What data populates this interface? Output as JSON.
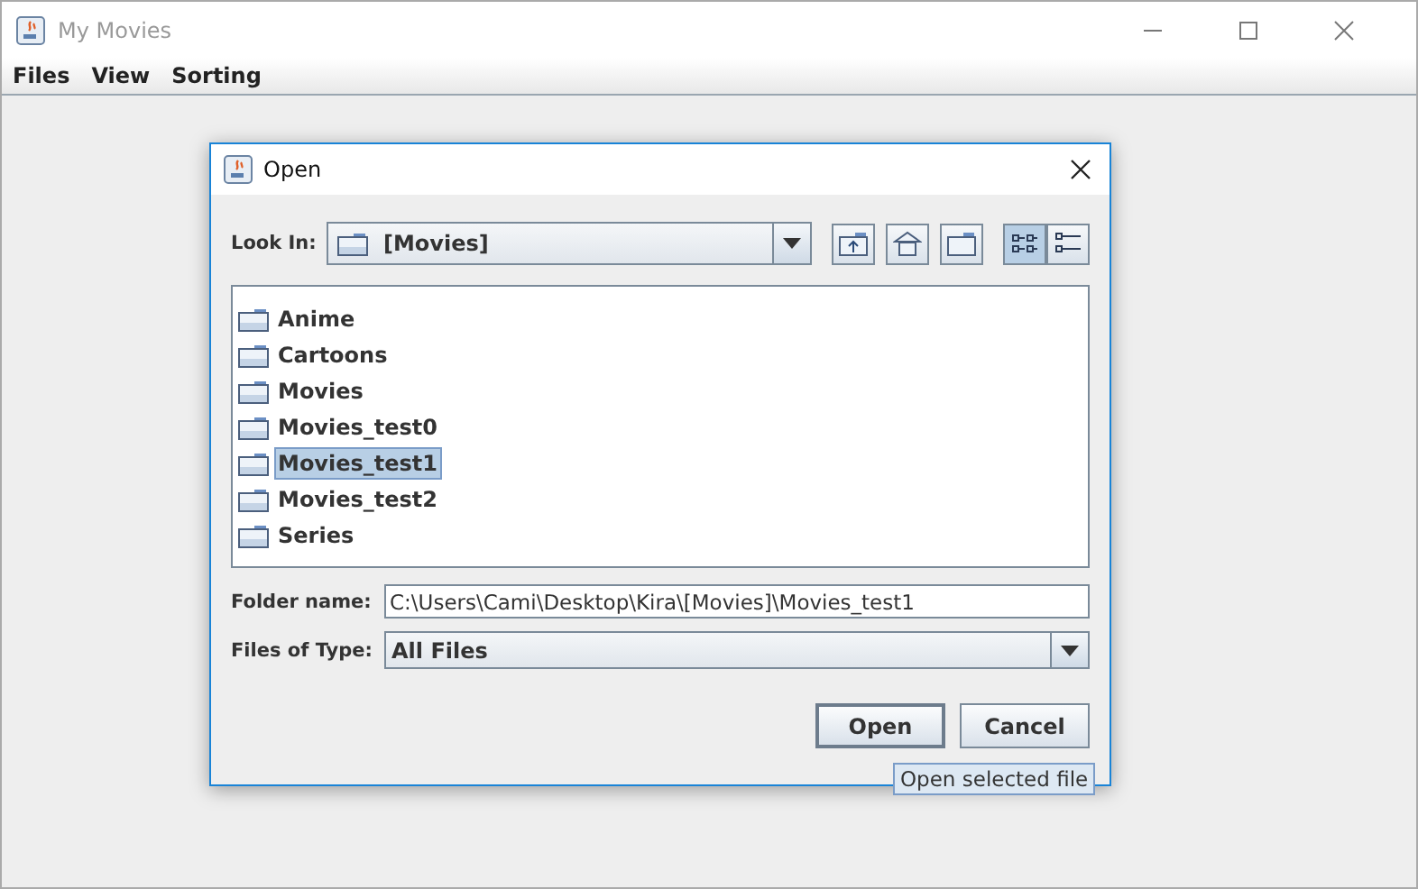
{
  "window": {
    "title": "My Movies"
  },
  "menu": [
    "Files",
    "View",
    "Sorting"
  ],
  "dialog": {
    "title": "Open",
    "look_in": {
      "label": "Look In:",
      "value": "[Movies]"
    },
    "toolbar": [
      {
        "kind": "up",
        "selected": false
      },
      {
        "kind": "home",
        "selected": false
      },
      {
        "kind": "new-folder",
        "selected": false
      },
      {
        "kind": "list",
        "selected": true
      },
      {
        "kind": "details",
        "selected": false
      }
    ],
    "files": [
      {
        "name": "Anime",
        "selected": false
      },
      {
        "name": "Cartoons",
        "selected": false
      },
      {
        "name": "Movies",
        "selected": false
      },
      {
        "name": "Movies_test0",
        "selected": false
      },
      {
        "name": "Movies_test1",
        "selected": true
      },
      {
        "name": "Movies_test2",
        "selected": false
      },
      {
        "name": "Series",
        "selected": false
      }
    ],
    "folder_name": {
      "label": "Folder name:",
      "value": "C:\\Users\\Cami\\Desktop\\Kira\\[Movies]\\Movies_test1"
    },
    "files_of_type": {
      "label": "Files of Type:",
      "value": "All Files"
    },
    "buttons": [
      "Open",
      "Cancel"
    ],
    "tooltip": "Open selected file"
  }
}
